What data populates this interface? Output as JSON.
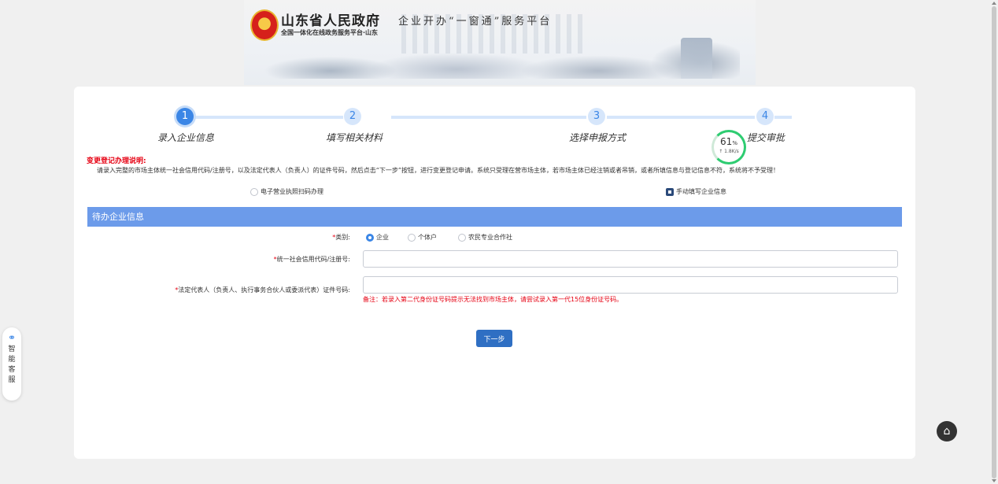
{
  "header": {
    "gov_title": "山东省人民政府",
    "gov_subtitle": "全国一体化在线政务服务平台·山东",
    "platform_name": "企业开办“一窗通”服务平台"
  },
  "steps": [
    {
      "num": "1",
      "label": "录入企业信息",
      "active": true
    },
    {
      "num": "2",
      "label": "填写相关材料",
      "active": false
    },
    {
      "num": "3",
      "label": "选择申报方式",
      "active": false
    },
    {
      "num": "4",
      "label": "提交审批",
      "active": false
    }
  ],
  "speed_widget": {
    "percent": "61",
    "percent_unit": "%",
    "rate": "↑ 1.8K/s"
  },
  "notice": {
    "title": "变更登记办理说明:",
    "text": "请录入完整的市场主体统一社会信用代码/注册号，以及法定代表人（负责人）的证件号码，然后点击“下一步”按钮，进行变更登记申请。系统只受理在营市场主体，若市场主体已经注销或者吊销，或者所填信息与登记信息不符，系统将不予受理！"
  },
  "mode_options": [
    {
      "label": "电子营业执照扫码办理",
      "selected": false
    },
    {
      "label": "手动填写企业信息",
      "selected": true
    }
  ],
  "section": {
    "title": "待办企业信息"
  },
  "form": {
    "category_label": "类别:",
    "category_options": [
      {
        "label": "企业",
        "selected": true
      },
      {
        "label": "个体户",
        "selected": false
      },
      {
        "label": "农民专业合作社",
        "selected": false
      }
    ],
    "credit_code_label": "统一社会信用代码/注册号:",
    "credit_code_value": "",
    "id_label": "法定代表人（负责人、执行事务合伙人或委派代表）证件号码:",
    "id_value": "",
    "remark": "备注：若录入第二代身份证号码提示无法找到市场主体，请尝试录入第一代15位身份证号码。",
    "required_mark": "*"
  },
  "next_button": "下一步",
  "side_service": {
    "label": "智能客服"
  },
  "colors": {
    "primary": "#3b86e6",
    "section_bar": "#6c9bea",
    "button": "#2f6fc3",
    "required": "#e60012"
  }
}
